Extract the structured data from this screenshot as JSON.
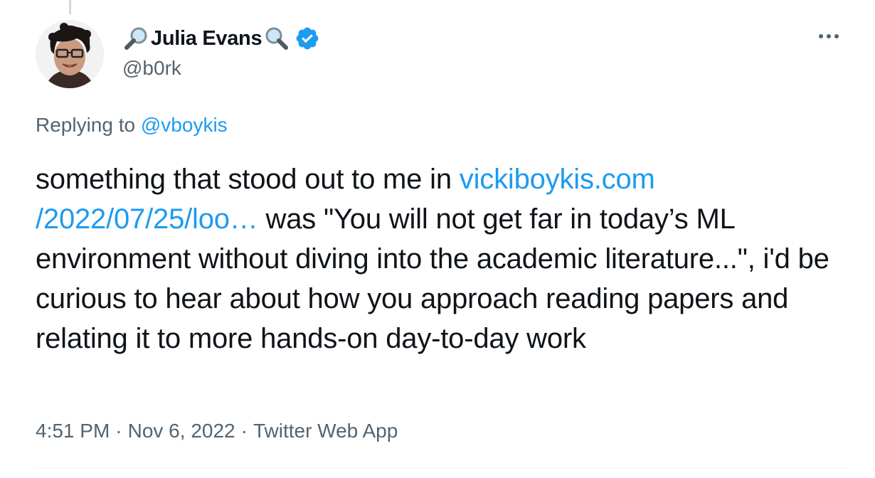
{
  "author": {
    "display_name": "Julia Evans",
    "handle": "@b0rk",
    "name_prefix_emoji": "magnifying-glass-tilted-left-icon",
    "name_suffix_emoji": "magnifying-glass-tilted-right-icon",
    "verified": true,
    "verified_color": "#1d9bf0"
  },
  "more_options_icon": "more-horizontal-icon",
  "replying": {
    "prefix": "Replying to",
    "mention": "@vboykis"
  },
  "tweet": {
    "text_before_link": "something that stood out to me in",
    "link_line1": "vickiboykis.com",
    "link_line2": "/2022/07/25/loo…",
    "text_after_link": " was \"You will not get far in today’s ML environment without diving into the academic literature...\", i'd be curious to hear about how you approach reading papers and relating it to more hands-on day-to-day work"
  },
  "meta": {
    "time": "4:51 PM",
    "date": "Nov 6, 2022",
    "source": "Twitter Web App",
    "separator": "·"
  },
  "colors": {
    "text": "#0f1419",
    "secondary": "#536471",
    "link": "#1d9bf0"
  }
}
